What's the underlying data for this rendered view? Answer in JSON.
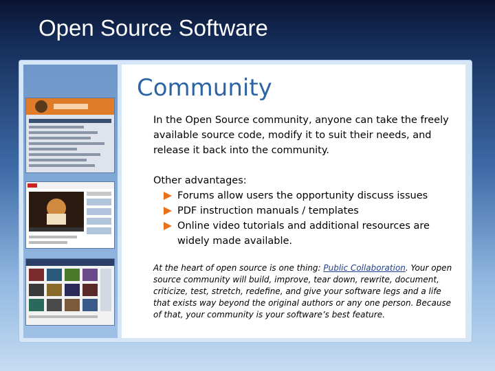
{
  "slide": {
    "title": "Open Source Software"
  },
  "content": {
    "heading": "Community",
    "intro": "In the Open Source community, anyone can take the freely available source code, modify it to suit their needs, and release it back into the community.",
    "advantages_heading": "Other advantages:",
    "advantages": [
      "Forums allow users the opportunity discuss issues",
      "PDF instruction manuals / templates",
      "Online video tutorials and additional resources are widely made available."
    ],
    "footer": {
      "before_link": "At the heart of open source is one thing: ",
      "link_text": "Public Collaboration",
      "after_link": ". Your open source community will build, improve, tear down, rewrite, document, criticize, test, stretch, redefine, and give your software legs and a life that exists way beyond the original authors or any one person. Because of that, your community is your software’s best feature."
    }
  },
  "colors": {
    "heading": "#2d64a4",
    "bullet_arrow": "#e8731a",
    "link": "#1f3f8f"
  },
  "icons": {
    "bullet": "arrow-right-icon"
  }
}
